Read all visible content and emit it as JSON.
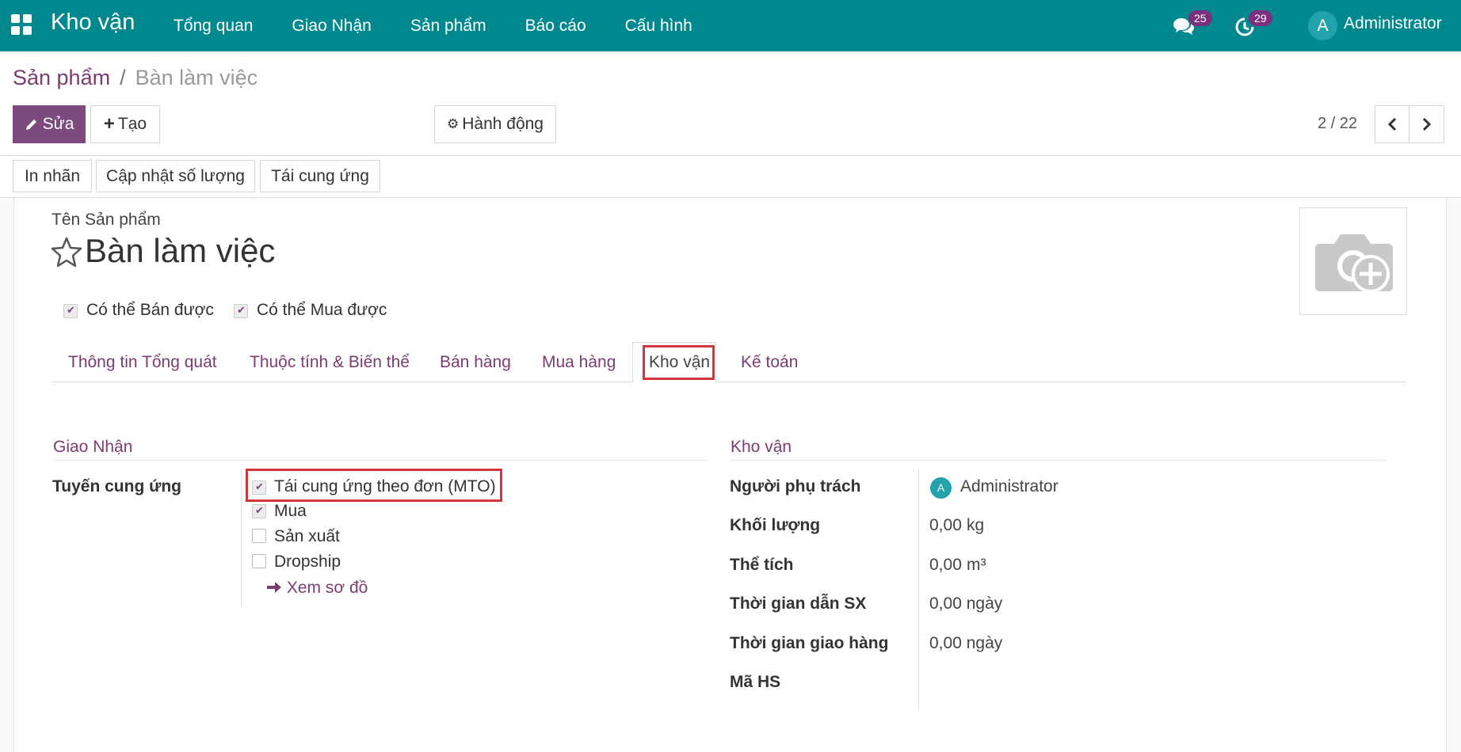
{
  "navbar": {
    "brand": "Kho vận",
    "menu": [
      "Tổng quan",
      "Giao Nhận",
      "Sản phẩm",
      "Báo cáo",
      "Cấu hình"
    ],
    "messages_badge": "25",
    "activities_badge": "29",
    "user_initial": "A",
    "user_name": "Administrator"
  },
  "breadcrumb": {
    "parent": "Sản phẩm",
    "separator": "/",
    "current": "Bàn làm việc"
  },
  "toolbar": {
    "edit_label": "Sửa",
    "create_label": "Tạo",
    "action_label": "Hành động",
    "pager": "2 / 22"
  },
  "header_buttons": [
    "In nhãn",
    "Cập nhật số lượng",
    "Tái cung ứng"
  ],
  "product": {
    "name_label": "Tên Sản phẩm",
    "name": "Bàn làm việc",
    "can_sell_label": "Có thể Bán được",
    "can_purchase_label": "Có thể Mua được"
  },
  "tabs": [
    "Thông tin Tổng quát",
    "Thuộc tính & Biến thể",
    "Bán hàng",
    "Mua hàng",
    "Kho vận",
    "Kế toán"
  ],
  "active_tab": "Kho vận",
  "operations": {
    "title": "Giao Nhận",
    "routes_label": "Tuyến cung ứng",
    "routes": [
      {
        "label": "Tái cung ứng theo đơn (MTO)",
        "checked": true
      },
      {
        "label": "Mua",
        "checked": true
      },
      {
        "label": "Sản xuất",
        "checked": false
      },
      {
        "label": "Dropship",
        "checked": false
      }
    ],
    "diagram_link": "Xem sơ đồ"
  },
  "logistics": {
    "title": "Kho vận",
    "fields": [
      {
        "label": "Người phụ trách",
        "value": "Administrator",
        "avatar": "A"
      },
      {
        "label": "Khối lượng",
        "value": "0,00",
        "unit": "kg"
      },
      {
        "label": "Thể tích",
        "value": "0,00",
        "unit": "m³"
      },
      {
        "label": "Thời gian dẫn SX",
        "value": "0,00 ngày"
      },
      {
        "label": "Thời gian giao hàng",
        "value": "0,00 ngày"
      },
      {
        "label": "Mã HS",
        "value": ""
      }
    ]
  },
  "colors": {
    "navbar": "#00888f",
    "primary": "#7c4a7e",
    "link": "#7c3c73",
    "highlight": "#d0363a"
  }
}
